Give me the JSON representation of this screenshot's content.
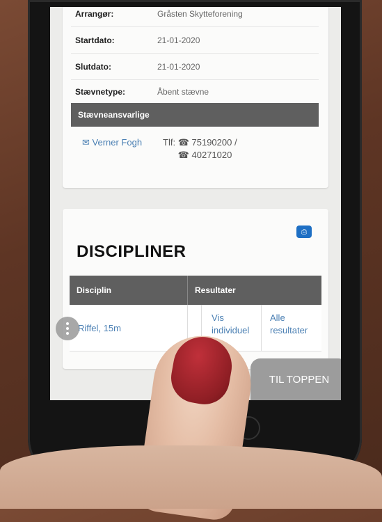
{
  "info": {
    "rows": [
      {
        "label": "Arrangør:",
        "value": "Gråsten Skytteforening"
      },
      {
        "label": "Startdato:",
        "value": "21-01-2020"
      },
      {
        "label": "Slutdato:",
        "value": "21-01-2020"
      },
      {
        "label": "Stævnetype:",
        "value": "Åbent stævne"
      }
    ],
    "responsible_header": "Stævneansvarlige",
    "contact_name": "Verner Fogh",
    "tel_label": "Tlf:",
    "phone1": "75190200 /",
    "phone2": "40271020"
  },
  "disciplines": {
    "title": "DISCIPLINER",
    "col_discipline": "Disciplin",
    "col_results": "Resultater",
    "rows": [
      {
        "name": "Riffel, 15m",
        "individual": "Vis individuel",
        "all": "Alle resultater"
      }
    ]
  },
  "to_top_label": "TIL TOPPEN",
  "icons": {
    "mail": "mail-icon",
    "phone": "phone-icon",
    "print": "print-icon"
  },
  "colors": {
    "accent": "#1e6fc4",
    "header": "#5f5f5f",
    "link": "#4a7fb3"
  }
}
